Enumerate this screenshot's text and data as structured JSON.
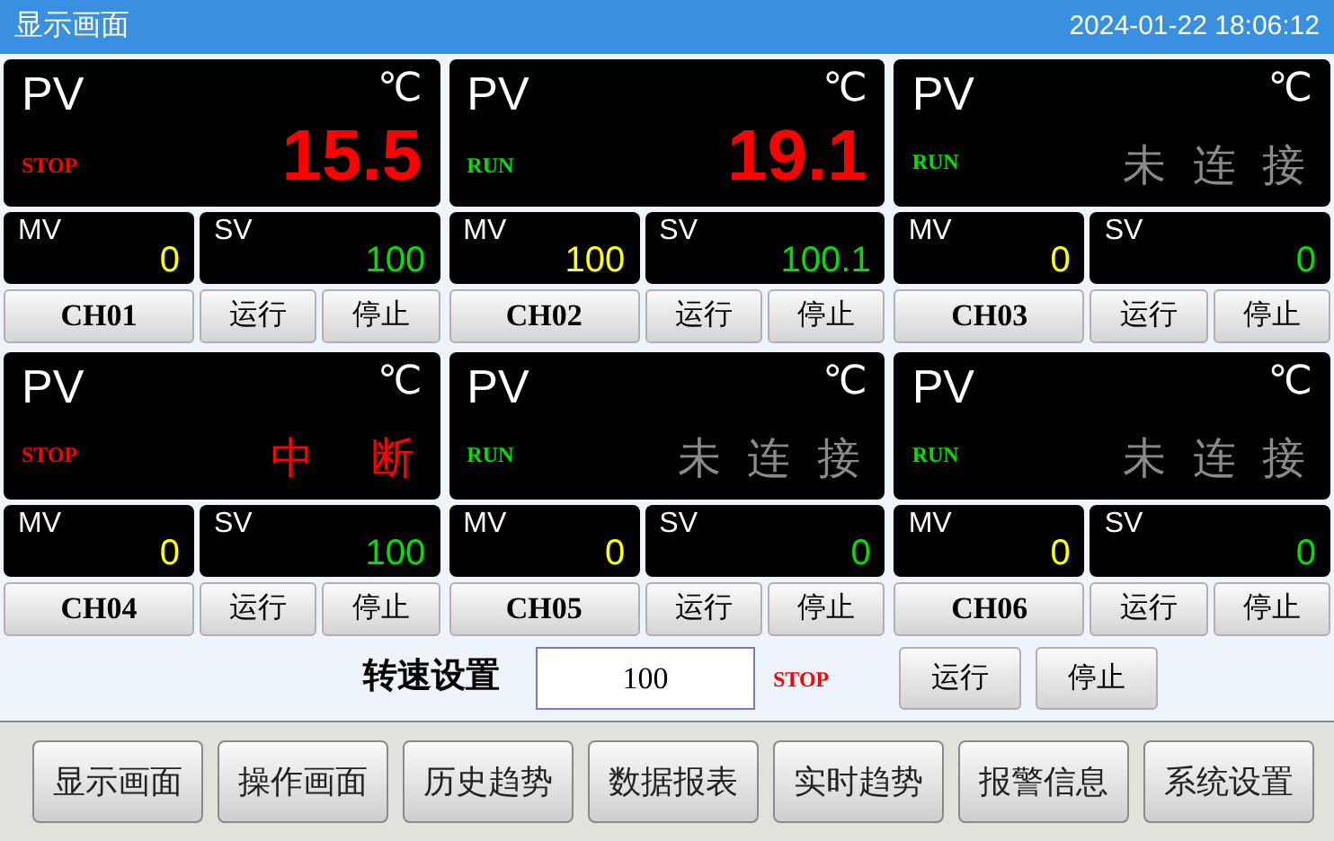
{
  "title_bar": {
    "title": "显示画面",
    "datetime": "2024-01-22 18:06:12"
  },
  "channels": [
    {
      "pv_label": "PV",
      "unit": "℃",
      "status": {
        "kind": "stop",
        "text": "STOP"
      },
      "pv": {
        "kind": "value",
        "text": "15.5"
      },
      "mv_label": "MV",
      "mv": "0",
      "sv_label": "SV",
      "sv": "100",
      "name": "CH01",
      "run": "运行",
      "stop": "停止"
    },
    {
      "pv_label": "PV",
      "unit": "℃",
      "status": {
        "kind": "run",
        "text": "RUN"
      },
      "pv": {
        "kind": "value",
        "text": "19.1"
      },
      "mv_label": "MV",
      "mv": "100",
      "sv_label": "SV",
      "sv": "100.1",
      "name": "CH02",
      "run": "运行",
      "stop": "停止"
    },
    {
      "pv_label": "PV",
      "unit": "℃",
      "status": {
        "kind": "run",
        "text": "RUN"
      },
      "pv": {
        "kind": "offline",
        "text": "未 连 接"
      },
      "mv_label": "MV",
      "mv": "0",
      "sv_label": "SV",
      "sv": "0",
      "name": "CH03",
      "run": "运行",
      "stop": "停止"
    },
    {
      "pv_label": "PV",
      "unit": "℃",
      "status": {
        "kind": "stop",
        "text": "STOP"
      },
      "pv": {
        "kind": "fault",
        "text": "中　断"
      },
      "mv_label": "MV",
      "mv": "0",
      "sv_label": "SV",
      "sv": "100",
      "name": "CH04",
      "run": "运行",
      "stop": "停止"
    },
    {
      "pv_label": "PV",
      "unit": "℃",
      "status": {
        "kind": "run",
        "text": "RUN"
      },
      "pv": {
        "kind": "offline",
        "text": "未 连 接"
      },
      "mv_label": "MV",
      "mv": "0",
      "sv_label": "SV",
      "sv": "0",
      "name": "CH05",
      "run": "运行",
      "stop": "停止"
    },
    {
      "pv_label": "PV",
      "unit": "℃",
      "status": {
        "kind": "run",
        "text": "RUN"
      },
      "pv": {
        "kind": "offline",
        "text": "未 连 接"
      },
      "mv_label": "MV",
      "mv": "0",
      "sv_label": "SV",
      "sv": "0",
      "name": "CH06",
      "run": "运行",
      "stop": "停止"
    }
  ],
  "speed": {
    "label": "转速设置",
    "value": "100",
    "status": {
      "kind": "stop",
      "text": "STOP"
    },
    "run": "运行",
    "stop": "停止"
  },
  "nav": [
    {
      "label": "显示画面"
    },
    {
      "label": "操作画面"
    },
    {
      "label": "历史趋势"
    },
    {
      "label": "数据报表"
    },
    {
      "label": "实时趋势"
    },
    {
      "label": "报警信息"
    },
    {
      "label": "系统设置"
    }
  ]
}
